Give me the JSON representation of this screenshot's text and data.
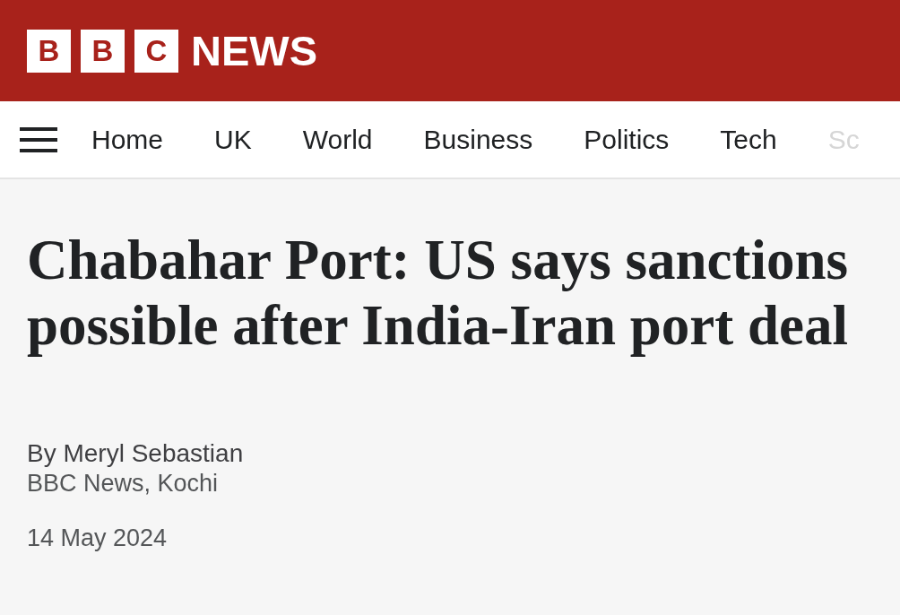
{
  "header": {
    "logo_letters": [
      "B",
      "B",
      "C"
    ],
    "brand": "NEWS"
  },
  "nav": {
    "items": [
      {
        "label": "Home",
        "faded": false
      },
      {
        "label": "UK",
        "faded": false
      },
      {
        "label": "World",
        "faded": false
      },
      {
        "label": "Business",
        "faded": false
      },
      {
        "label": "Politics",
        "faded": false
      },
      {
        "label": "Tech",
        "faded": false
      },
      {
        "label": "Sc",
        "faded": true
      }
    ]
  },
  "article": {
    "headline": "Chabahar Port: US says sanctions possible after India-Iran port deal",
    "byline": "By Meryl Sebastian",
    "source": "BBC News, Kochi",
    "date": "14 May 2024"
  }
}
